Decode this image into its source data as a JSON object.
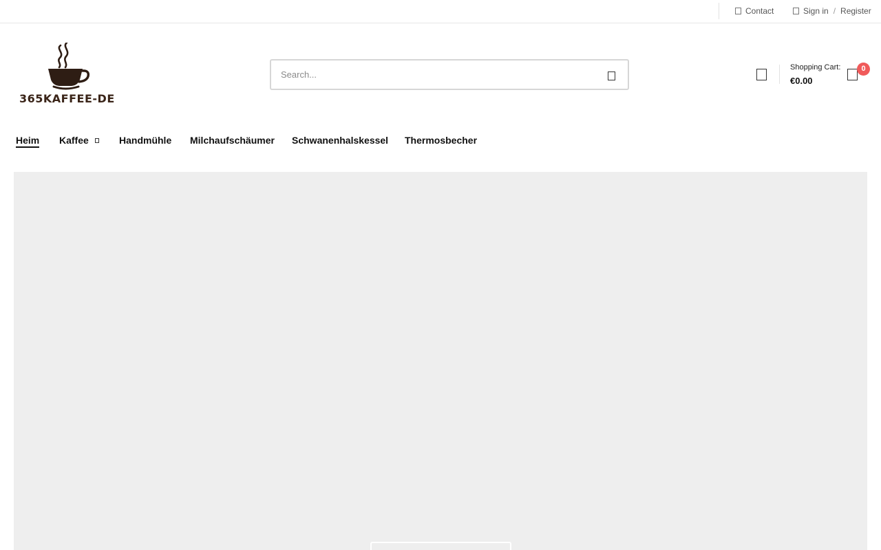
{
  "topbar": {
    "contact_label": "Contact",
    "sign_in_label": "Sign in",
    "separator": "/",
    "register_label": "Register",
    "contact_icon": "phone-icon",
    "account_icon": "user-icon"
  },
  "brand": {
    "name": "365KAFFEE-DE",
    "color": "#3a2418"
  },
  "search": {
    "placeholder": "Search...",
    "value": "",
    "icon": "search-icon"
  },
  "header": {
    "wishlist_icon": "heart-icon",
    "cart_label": "Shopping Cart:",
    "cart_total": "€0.00",
    "cart_count": "0",
    "cart_icon": "bag-icon",
    "badge_color": "#f05a5a"
  },
  "nav": {
    "items": [
      {
        "label": "Heim",
        "active": true
      },
      {
        "label": "Kaffee",
        "has_dropdown": true
      },
      {
        "label": "Handmühle"
      },
      {
        "label": "Milchaufschäumer"
      },
      {
        "label": "Schwanenhalskessel"
      },
      {
        "label": "Thermosbecher"
      }
    ]
  }
}
